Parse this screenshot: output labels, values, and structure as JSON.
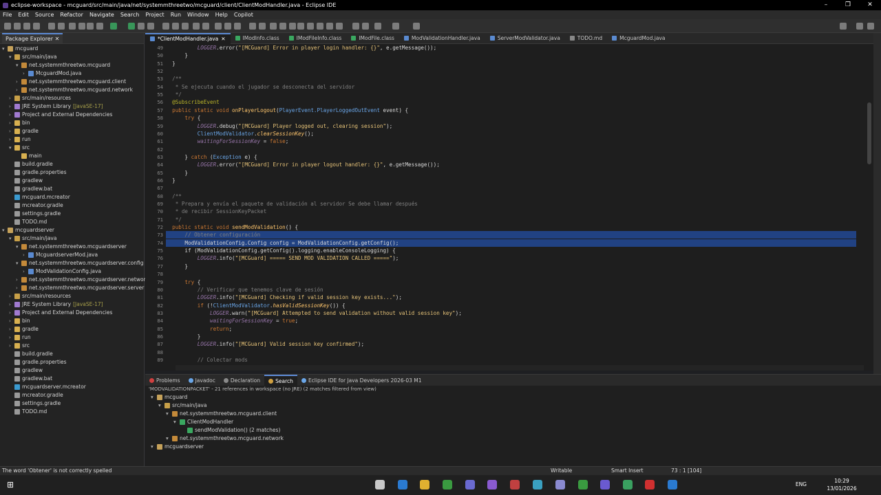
{
  "window": {
    "title": "eclipse-workspace - mcguard/src/main/java/net/systemmthreetwo/mcguard/client/ClientModHandler.java - Eclipse IDE",
    "controls": [
      "–",
      "❐",
      "✕"
    ]
  },
  "menu": [
    "File",
    "Edit",
    "Source",
    "Refactor",
    "Navigate",
    "Search",
    "Project",
    "Run",
    "Window",
    "Help",
    "Copilot"
  ],
  "package_explorer": {
    "title": "Package Explorer",
    "tree": [
      {
        "label": "mcguard",
        "indent": 0,
        "open": true,
        "icon": "project"
      },
      {
        "label": "src/main/java",
        "indent": 1,
        "open": true,
        "icon": "src"
      },
      {
        "label": "net.systemmthreetwo.mcguard",
        "indent": 2,
        "open": true,
        "icon": "pkg"
      },
      {
        "label": "McguardMod.java",
        "indent": 3,
        "open": false,
        "icon": "java"
      },
      {
        "label": "net.systemmthreetwo.mcguard.client",
        "indent": 2,
        "open": false,
        "icon": "pkg"
      },
      {
        "label": "net.systemmthreetwo.mcguard.network",
        "indent": 2,
        "open": false,
        "icon": "pkg"
      },
      {
        "label": "src/main/resources",
        "indent": 1,
        "open": false,
        "icon": "src"
      },
      {
        "label": "JRE System Library",
        "hint": "[JavaSE-17]",
        "indent": 1,
        "open": false,
        "icon": "lib"
      },
      {
        "label": "Project and External Dependencies",
        "indent": 1,
        "open": false,
        "icon": "lib"
      },
      {
        "label": "bin",
        "indent": 1,
        "open": false,
        "icon": "folder"
      },
      {
        "label": "gradle",
        "indent": 1,
        "open": false,
        "icon": "folder"
      },
      {
        "label": "run",
        "indent": 1,
        "open": false,
        "icon": "folder"
      },
      {
        "label": "src",
        "indent": 1,
        "open": true,
        "icon": "folder"
      },
      {
        "label": "main",
        "indent": 2,
        "open": null,
        "icon": "folder"
      },
      {
        "label": "build.gradle",
        "indent": 1,
        "open": null,
        "icon": "file"
      },
      {
        "label": "gradle.properties",
        "indent": 1,
        "open": null,
        "icon": "file"
      },
      {
        "label": "gradlew",
        "indent": 1,
        "open": null,
        "icon": "file"
      },
      {
        "label": "gradlew.bat",
        "indent": 1,
        "open": null,
        "icon": "file"
      },
      {
        "label": "mcguard.mcreator",
        "indent": 1,
        "open": null,
        "icon": "mcr"
      },
      {
        "label": "mcreator.gradle",
        "indent": 1,
        "open": null,
        "icon": "file"
      },
      {
        "label": "settings.gradle",
        "indent": 1,
        "open": null,
        "icon": "file"
      },
      {
        "label": "TODO.md",
        "indent": 1,
        "open": null,
        "icon": "file"
      },
      {
        "label": "mcguardserver",
        "indent": 0,
        "open": true,
        "icon": "project"
      },
      {
        "label": "src/main/java",
        "indent": 1,
        "open": true,
        "icon": "src"
      },
      {
        "label": "net.systemmthreetwo.mcguardserver",
        "indent": 2,
        "open": true,
        "icon": "pkg"
      },
      {
        "label": "McguardserverMod.java",
        "indent": 3,
        "open": false,
        "icon": "java"
      },
      {
        "label": "net.systemmthreetwo.mcguardserver.config",
        "indent": 2,
        "open": true,
        "icon": "pkg"
      },
      {
        "label": "ModValidationConfig.java",
        "indent": 3,
        "open": false,
        "icon": "java"
      },
      {
        "label": "net.systemmthreetwo.mcguardserver.network",
        "indent": 2,
        "open": false,
        "icon": "pkg"
      },
      {
        "label": "net.systemmthreetwo.mcguardserver.server",
        "indent": 2,
        "open": false,
        "icon": "pkg"
      },
      {
        "label": "src/main/resources",
        "indent": 1,
        "open": false,
        "icon": "src"
      },
      {
        "label": "JRE System Library",
        "hint": "[JavaSE-17]",
        "indent": 1,
        "open": false,
        "icon": "lib"
      },
      {
        "label": "Project and External Dependencies",
        "indent": 1,
        "open": false,
        "icon": "lib"
      },
      {
        "label": "bin",
        "indent": 1,
        "open": false,
        "icon": "folder"
      },
      {
        "label": "gradle",
        "indent": 1,
        "open": false,
        "icon": "folder"
      },
      {
        "label": "run",
        "indent": 1,
        "open": false,
        "icon": "folder"
      },
      {
        "label": "src",
        "indent": 1,
        "open": false,
        "icon": "folder"
      },
      {
        "label": "build.gradle",
        "indent": 1,
        "open": null,
        "icon": "file"
      },
      {
        "label": "gradle.properties",
        "indent": 1,
        "open": null,
        "icon": "file"
      },
      {
        "label": "gradlew",
        "indent": 1,
        "open": null,
        "icon": "file"
      },
      {
        "label": "gradlew.bat",
        "indent": 1,
        "open": null,
        "icon": "file"
      },
      {
        "label": "mcguardserver.mcreator",
        "indent": 1,
        "open": null,
        "icon": "mcr"
      },
      {
        "label": "mcreator.gradle",
        "indent": 1,
        "open": null,
        "icon": "file"
      },
      {
        "label": "settings.gradle",
        "indent": 1,
        "open": null,
        "icon": "file"
      },
      {
        "label": "TODO.md",
        "indent": 1,
        "open": null,
        "icon": "file"
      }
    ]
  },
  "editor_tabs": [
    {
      "label": "*ClientModHandler.java",
      "active": true,
      "icon": "java"
    },
    {
      "label": "IModInfo.class",
      "active": false,
      "icon": "class"
    },
    {
      "label": "IModFileInfo.class",
      "active": false,
      "icon": "class"
    },
    {
      "label": "IModFile.class",
      "active": false,
      "icon": "class"
    },
    {
      "label": "ModValidationHandler.java",
      "active": false,
      "icon": "java"
    },
    {
      "label": "ServerModValidator.java",
      "active": false,
      "icon": "java"
    },
    {
      "label": "TODO.md",
      "active": false,
      "icon": "md"
    },
    {
      "label": "McguardMod.java",
      "active": false,
      "icon": "java"
    }
  ],
  "code": [
    {
      "n": "49",
      "segs": [
        [
          "          ",
          ""
        ],
        [
          "LOGGER",
          "fld"
        ],
        [
          ".error(",
          ""
        ],
        [
          "\"[MCGuard] Error in player login handler: {}\"",
          "str"
        ],
        [
          ", e.getMessage());",
          ""
        ]
      ]
    },
    {
      "n": "50",
      "segs": [
        [
          "      }",
          ""
        ]
      ]
    },
    {
      "n": "51",
      "segs": [
        [
          "  }",
          ""
        ]
      ]
    },
    {
      "n": "52",
      "segs": [
        [
          "",
          ""
        ]
      ]
    },
    {
      "n": "53",
      "segs": [
        [
          "  /**",
          "cm"
        ]
      ]
    },
    {
      "n": "54",
      "segs": [
        [
          "   * Se ejecuta cuando el jugador se desconecta del servidor",
          "cm"
        ]
      ]
    },
    {
      "n": "55",
      "segs": [
        [
          "   */",
          "cm"
        ]
      ]
    },
    {
      "n": "56",
      "segs": [
        [
          "  @SubscribeEvent",
          "ann"
        ]
      ]
    },
    {
      "n": "57",
      "segs": [
        [
          "  public static void ",
          "kw"
        ],
        [
          "onPlayerLogout",
          "meth"
        ],
        [
          "(",
          ""
        ],
        [
          "PlayerEvent.PlayerLoggedOutEvent",
          "cls"
        ],
        [
          " event) {",
          ""
        ]
      ]
    },
    {
      "n": "58",
      "segs": [
        [
          "      try",
          "kw"
        ],
        [
          " {",
          ""
        ]
      ]
    },
    {
      "n": "59",
      "segs": [
        [
          "          ",
          ""
        ],
        [
          "LOGGER",
          "fld"
        ],
        [
          ".debug(",
          ""
        ],
        [
          "\"[MCGuard] Player logged out, clearing session\"",
          "str"
        ],
        [
          ");",
          ""
        ]
      ]
    },
    {
      "n": "60",
      "segs": [
        [
          "          ",
          ""
        ],
        [
          "ClientModValidator",
          "cls"
        ],
        [
          ".",
          ""
        ],
        [
          "clearSessionKey",
          "meth ital"
        ],
        [
          "();",
          ""
        ]
      ]
    },
    {
      "n": "61",
      "segs": [
        [
          "          ",
          ""
        ],
        [
          "waitingForSessionKey",
          "fld"
        ],
        [
          " = ",
          ""
        ],
        [
          "false",
          "kw"
        ],
        [
          ";",
          ""
        ]
      ]
    },
    {
      "n": "62",
      "segs": [
        [
          "",
          ""
        ]
      ]
    },
    {
      "n": "63",
      "segs": [
        [
          "      } ",
          ""
        ],
        [
          "catch",
          "kw"
        ],
        [
          " (",
          ""
        ],
        [
          "Exception",
          "cls"
        ],
        [
          " e) {",
          ""
        ]
      ]
    },
    {
      "n": "64",
      "segs": [
        [
          "          ",
          ""
        ],
        [
          "LOGGER",
          "fld"
        ],
        [
          ".error(",
          ""
        ],
        [
          "\"[MCGuard] Error in player logout handler: {}\"",
          "str"
        ],
        [
          ", e.getMessage());",
          ""
        ]
      ]
    },
    {
      "n": "65",
      "segs": [
        [
          "      }",
          ""
        ]
      ]
    },
    {
      "n": "66",
      "segs": [
        [
          "  }",
          ""
        ]
      ]
    },
    {
      "n": "67",
      "segs": [
        [
          "",
          ""
        ]
      ]
    },
    {
      "n": "68",
      "segs": [
        [
          "  /**",
          "cm"
        ]
      ]
    },
    {
      "n": "69",
      "segs": [
        [
          "   * Prepara y envía el paquete de validación al servidor Se debe llamar después",
          "cm"
        ]
      ]
    },
    {
      "n": "70",
      "segs": [
        [
          "   * de recibir SessionKeyPacket",
          "cm"
        ]
      ]
    },
    {
      "n": "71",
      "segs": [
        [
          "   */",
          "cm"
        ]
      ]
    },
    {
      "n": "72",
      "segs": [
        [
          "  public static void ",
          "kw"
        ],
        [
          "sendModValidation",
          "meth"
        ],
        [
          "() {",
          ""
        ]
      ]
    },
    {
      "n": "73",
      "sel": true,
      "segs": [
        [
          "      // Obtener configuración",
          "cm"
        ]
      ]
    },
    {
      "n": "74",
      "sel": true,
      "segs": [
        [
          "      ModValidationConfig.Config config = ModValidationConfig.getConfig();",
          ""
        ]
      ]
    },
    {
      "n": "75",
      "segs": [
        [
          "      if (ModValidationConfig.getConfig().logging.enableConsoleLogging) {",
          ""
        ]
      ]
    },
    {
      "n": "76",
      "segs": [
        [
          "          ",
          ""
        ],
        [
          "LOGGER",
          "fld"
        ],
        [
          ".info(",
          ""
        ],
        [
          "\"[MCGuard] ===== SEND MOD VALIDATION CALLED =====\"",
          "str"
        ],
        [
          ");",
          ""
        ]
      ]
    },
    {
      "n": "77",
      "segs": [
        [
          "      }",
          ""
        ]
      ]
    },
    {
      "n": "78",
      "segs": [
        [
          "",
          ""
        ]
      ]
    },
    {
      "n": "79",
      "segs": [
        [
          "      try",
          "kw"
        ],
        [
          " {",
          ""
        ]
      ]
    },
    {
      "n": "80",
      "segs": [
        [
          "          // Verificar que tenemos clave de sesión",
          "cm"
        ]
      ]
    },
    {
      "n": "81",
      "segs": [
        [
          "          ",
          ""
        ],
        [
          "LOGGER",
          "fld"
        ],
        [
          ".info(",
          ""
        ],
        [
          "\"[MCGuard] Checking if valid session key exists...\"",
          "str"
        ],
        [
          ");",
          ""
        ]
      ]
    },
    {
      "n": "82",
      "segs": [
        [
          "          ",
          ""
        ],
        [
          "if",
          "kw"
        ],
        [
          " (!",
          ""
        ],
        [
          "ClientModValidator",
          "cls"
        ],
        [
          ".",
          ""
        ],
        [
          "hasValidSessionKey",
          "meth ital"
        ],
        [
          "()) {",
          ""
        ]
      ]
    },
    {
      "n": "83",
      "segs": [
        [
          "              ",
          ""
        ],
        [
          "LOGGER",
          "fld"
        ],
        [
          ".warn(",
          ""
        ],
        [
          "\"[MCGuard] Attempted to send validation without valid session key\"",
          "str"
        ],
        [
          ");",
          ""
        ]
      ]
    },
    {
      "n": "84",
      "segs": [
        [
          "              ",
          ""
        ],
        [
          "waitingForSessionKey",
          "fld"
        ],
        [
          " = ",
          ""
        ],
        [
          "true",
          "kw"
        ],
        [
          ";",
          ""
        ]
      ]
    },
    {
      "n": "85",
      "segs": [
        [
          "              ",
          ""
        ],
        [
          "return",
          "kw"
        ],
        [
          ";",
          ""
        ]
      ]
    },
    {
      "n": "86",
      "segs": [
        [
          "          }",
          ""
        ]
      ]
    },
    {
      "n": "87",
      "segs": [
        [
          "          ",
          ""
        ],
        [
          "LOGGER",
          "fld"
        ],
        [
          ".info(",
          ""
        ],
        [
          "\"[MCGuard] Valid session key confirmed\"",
          "str"
        ],
        [
          ");",
          ""
        ]
      ]
    },
    {
      "n": "88",
      "segs": [
        [
          "",
          ""
        ]
      ]
    },
    {
      "n": "89",
      "segs": [
        [
          "          // Colectar mods",
          "cm"
        ]
      ]
    }
  ],
  "bottom_tabs": [
    {
      "label": "Problems",
      "active": false,
      "color": "#d04040"
    },
    {
      "label": "Javadoc",
      "active": false,
      "color": "#6aa6e8"
    },
    {
      "label": "Declaration",
      "active": false,
      "color": "#8a8a8a"
    },
    {
      "label": "Search",
      "active": true,
      "color": "#d0a040"
    },
    {
      "label": "Eclipse IDE for Java Developers 2026-03 M1",
      "active": false,
      "color": "#6aa6e8"
    }
  ],
  "search": {
    "summary": "'MODVALIDATIONPACKET' - 21 references in workspace (no JRE) (2 matches filtered from view)",
    "results": [
      {
        "label": "mcguard",
        "indent": 0,
        "icon": "project"
      },
      {
        "label": "src/main/java",
        "indent": 1,
        "icon": "src"
      },
      {
        "label": "net.systemmthreetwo.mcguard.client",
        "indent": 2,
        "icon": "pkg"
      },
      {
        "label": "ClientModHandler",
        "indent": 3,
        "icon": "class"
      },
      {
        "label": "sendModValidation() (2 matches)",
        "indent": 4,
        "icon": "method"
      },
      {
        "label": "net.systemmthreetwo.mcguard.network",
        "indent": 2,
        "icon": "pkg"
      },
      {
        "label": "mcguardserver",
        "indent": 0,
        "icon": "project"
      }
    ]
  },
  "status": {
    "message": "The word 'Obtener' is not correctly spelled",
    "writable": "Writable",
    "insert": "Smart Insert",
    "position": "73 : 1 [104]"
  },
  "tray": {
    "lang": "ENG",
    "time": "10:29",
    "date": "13/01/2026"
  },
  "colors": {
    "selection": "#214283",
    "accent": "#5c8ad6"
  }
}
